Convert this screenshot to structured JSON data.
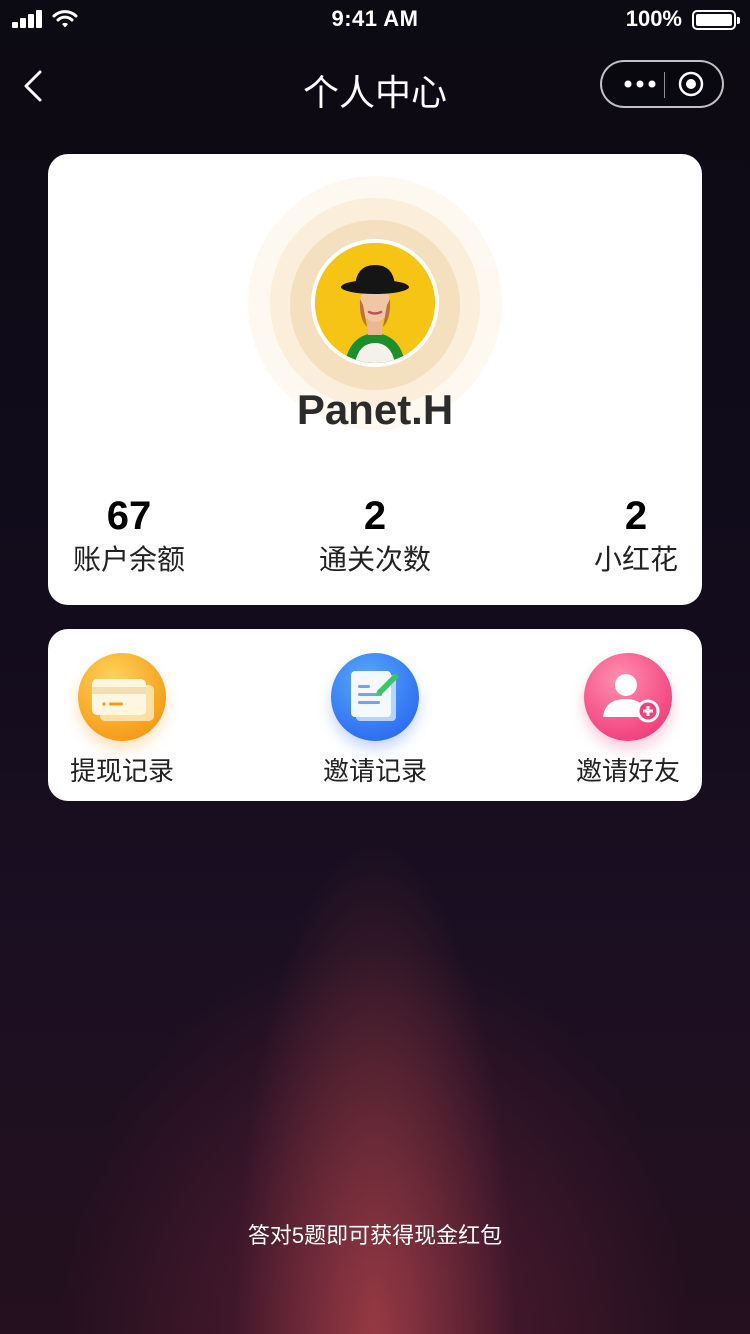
{
  "status_bar": {
    "time": "9:41 AM",
    "battery_text": "100%",
    "icons": [
      "signal-icon",
      "wifi-icon",
      "battery-icon"
    ]
  },
  "nav": {
    "title": "个人中心",
    "back_icon": "chevron-left-icon",
    "more_icon": "more-dots-icon",
    "close_icon": "target-icon"
  },
  "profile": {
    "name": "Panet.H",
    "stats": [
      {
        "value": "67",
        "label": "账户余额"
      },
      {
        "value": "2",
        "label": "通关次数"
      },
      {
        "value": "2",
        "label": "小红花"
      }
    ]
  },
  "actions": [
    {
      "label": "提现记录",
      "icon": "card-icon",
      "color": "#f7a22a"
    },
    {
      "label": "邀请记录",
      "icon": "document-edit-icon",
      "color": "#3a7cf2"
    },
    {
      "label": "邀请好友",
      "icon": "add-user-icon",
      "color": "#f24a84"
    }
  ],
  "footer": {
    "text": "答对5题即可获得现金红包"
  }
}
